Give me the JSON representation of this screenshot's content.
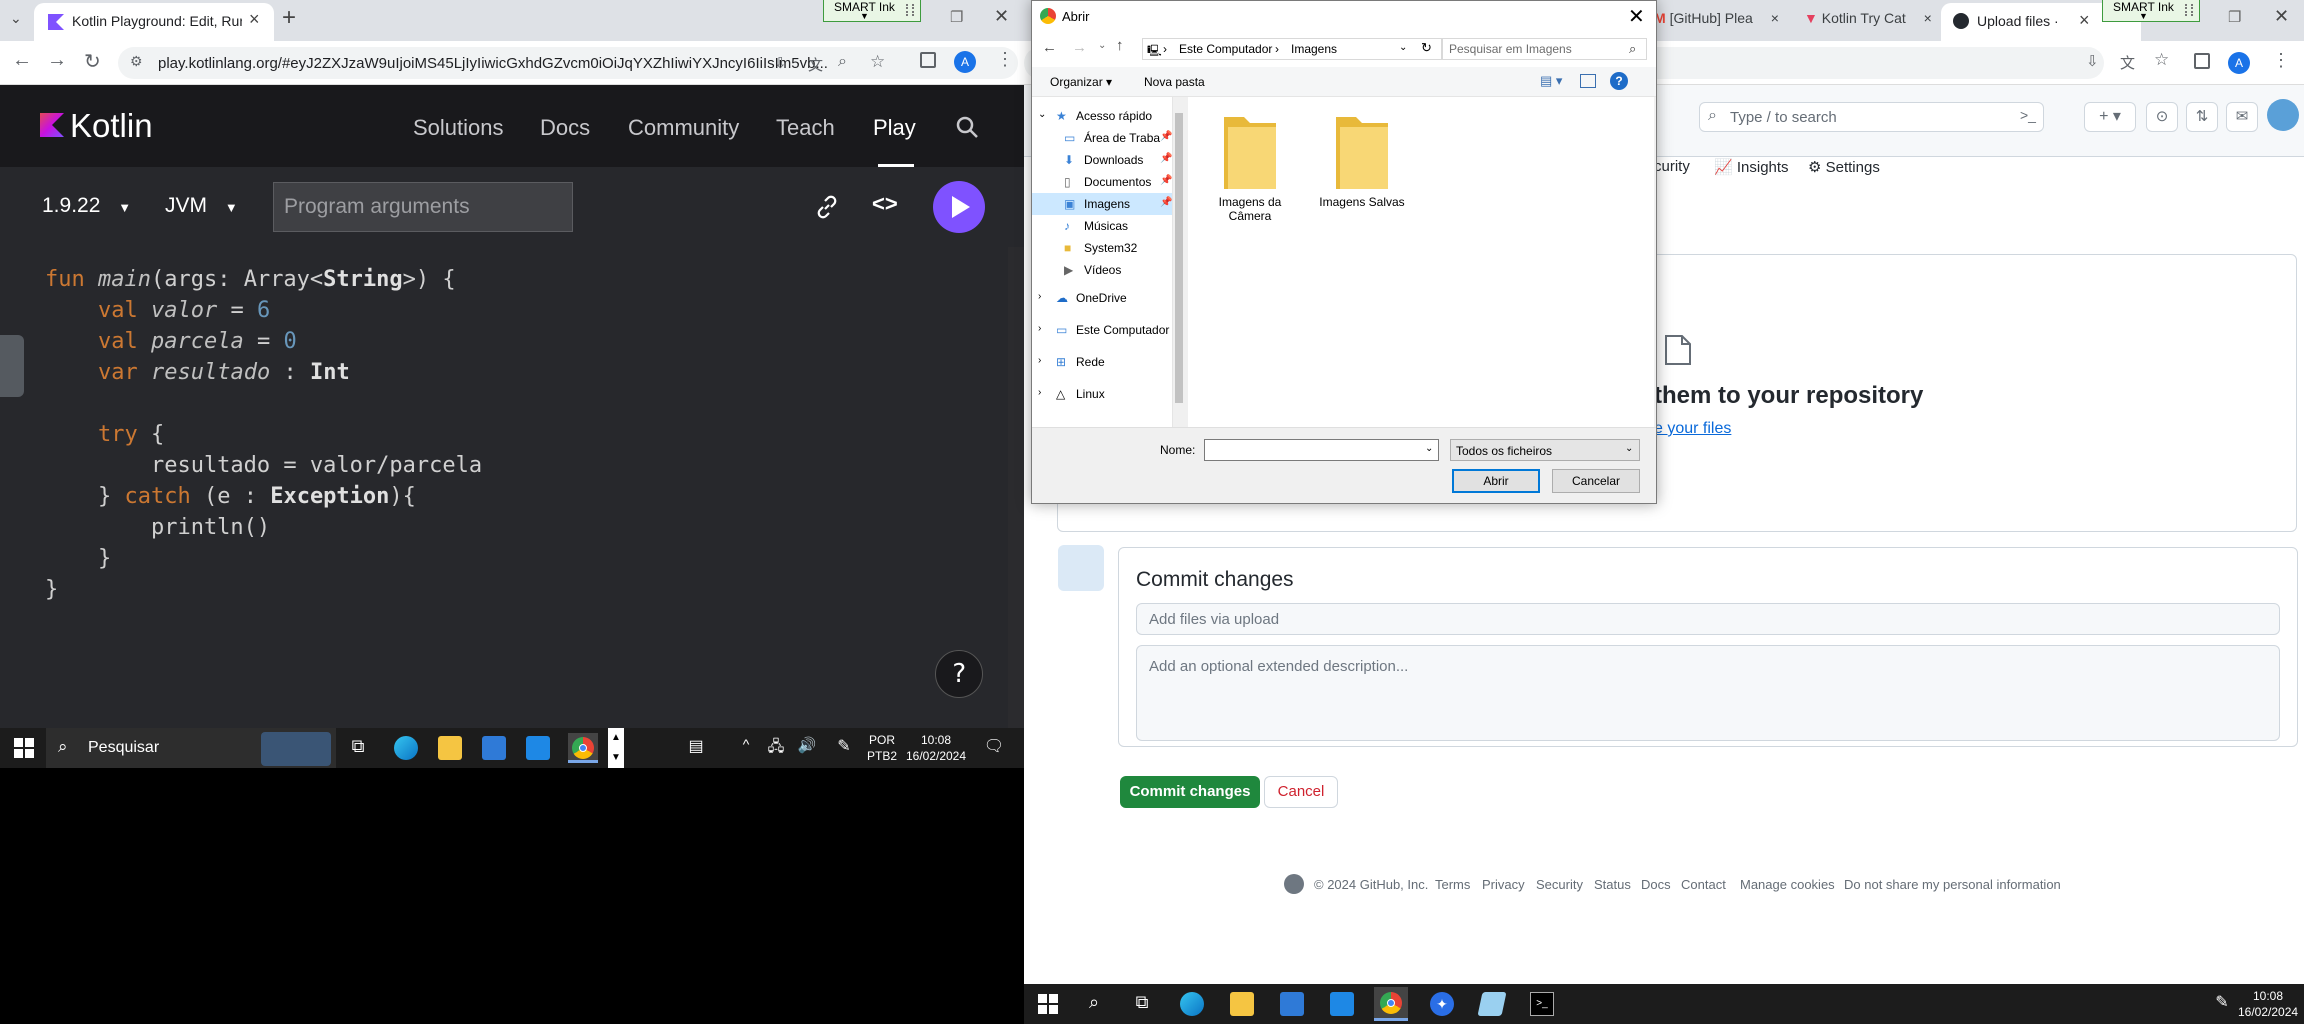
{
  "left_browser": {
    "tab_title": "Kotlin Playground: Edit, Run, Sh",
    "url": "play.kotlinlang.org/#eyJ2ZXJzaW9uIjoiMS45LjIyIiwicGxhdGZvcm0iOiJqYXZhIiwiYXJncyI6IiIsIm5vb..."
  },
  "kotlin": {
    "logo": "Kotlin",
    "nav": [
      "Solutions",
      "Docs",
      "Community",
      "Teach",
      "Play"
    ],
    "version": "1.9.22",
    "platform": "JVM",
    "args_placeholder": "Program arguments",
    "help": "?",
    "accent": "#7f52ff",
    "code": [
      "fun main(args: Array<String>) {",
      "    val valor = 6",
      "    val parcela = 0",
      "    var resultado : Int",
      "",
      "    try {",
      "        resultado = valor/parcela",
      "    } catch (e : Exception){",
      "        println()",
      "    }",
      "}"
    ]
  },
  "smart_ink": {
    "label": "SMART Ink"
  },
  "taskbar_left": {
    "search": "Pesquisar",
    "lang1": "POR",
    "lang2": "PTB2",
    "time": "10:08",
    "date": "16/02/2024"
  },
  "right_browser": {
    "tabs": [
      "[GitHub] Plea",
      "Kotlin Try Cat",
      "Upload files ·"
    ],
    "search_placeholder": "Type / to search",
    "subnav": [
      "curity",
      "Insights",
      "Settings"
    ]
  },
  "github": {
    "drop_title": "them to your repository",
    "drop_link": "e your files",
    "commit_title": "Commit changes",
    "commit_placeholder": "Add files via upload",
    "desc_placeholder": "Add an optional extended description...",
    "commit_button": "Commit changes",
    "cancel_button": "Cancel",
    "footer": [
      "© 2024 GitHub, Inc.",
      "Terms",
      "Privacy",
      "Security",
      "Status",
      "Docs",
      "Contact",
      "Manage cookies",
      "Do not share my personal information"
    ],
    "green": "#1f883d"
  },
  "taskbar_right": {
    "time": "10:08",
    "date": "16/02/2024"
  },
  "dialog": {
    "title": "Abrir",
    "path": [
      "Este Computador",
      "Imagens"
    ],
    "search_placeholder": "Pesquisar em Imagens",
    "organize": "Organizar",
    "new_folder": "Nova pasta",
    "tree": [
      "Acesso rápido",
      "Área de Traba",
      "Downloads",
      "Documentos",
      "Imagens",
      "Músicas",
      "System32",
      "Vídeos",
      "OneDrive",
      "Este Computador",
      "Rede",
      "Linux"
    ],
    "folders": [
      "Imagens da Câmera",
      "Imagens Salvas"
    ],
    "name_label": "Nome:",
    "name_value": "",
    "filter": "Todos os ficheiros",
    "open": "Abrir",
    "cancel": "Cancelar"
  }
}
